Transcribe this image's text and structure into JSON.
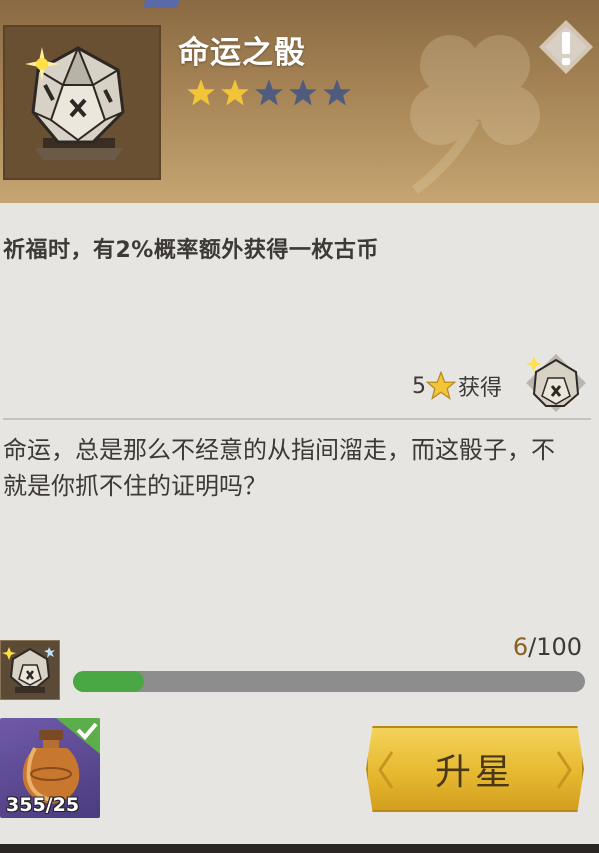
{
  "item": {
    "name": "命运之骰",
    "rarity_filled": 2,
    "rarity_total": 5,
    "effect": "祈福时，有2%概率额外获得一枚古币",
    "obtain_star": "5",
    "obtain_label": "获得",
    "flavor": "命运，总是那么不经意的从指间溜走，而这骰子，不就是你抓不住的证明吗？"
  },
  "progress": {
    "current": "6",
    "separator": "/",
    "max": "100",
    "fraction": 0.06
  },
  "material": {
    "count": "355/25"
  },
  "action": {
    "upgrade_label": "升星"
  },
  "colors": {
    "star_filled": "#f2c437",
    "star_empty": "#505c7e",
    "progress": "#4aa844",
    "button": "#e6b930"
  },
  "icons": {
    "warning": "warning-icon",
    "sparkle": "sparkle-icon",
    "check": "check-icon",
    "dice": "dice-icon",
    "urn": "urn-icon"
  }
}
